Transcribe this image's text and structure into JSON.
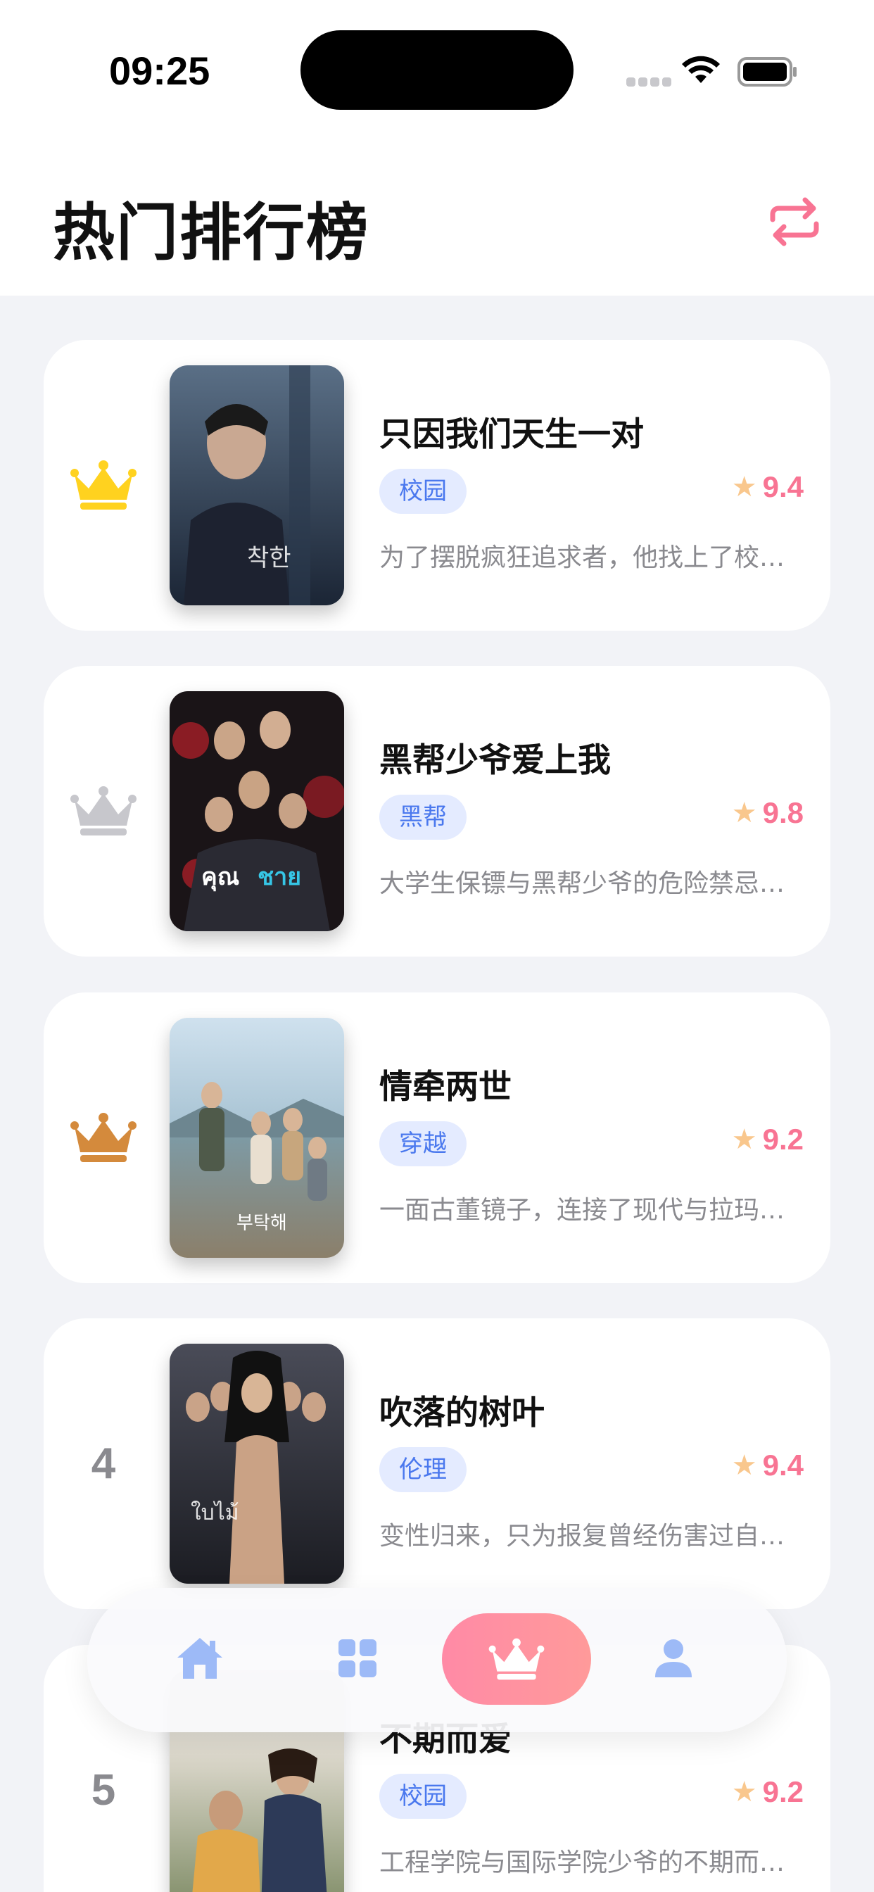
{
  "status_bar": {
    "time": "09:25"
  },
  "header": {
    "title": "热门排行榜"
  },
  "colors": {
    "accent": "#f87493",
    "tag_bg": "#e4ebff",
    "tag_text": "#4a78ee",
    "star": "#f9c78d",
    "gold": "#ffd21f",
    "silver": "#c7c7cc",
    "bronze": "#d48a3c",
    "tab_inactive": "#9dbaf7"
  },
  "rankings": [
    {
      "rank_icon": "crown-gold-icon",
      "title": "只因我们天生一对",
      "tag": "校园",
      "rating": "9.4",
      "desc": "为了摆脱疯狂追求者，他找上了校…"
    },
    {
      "rank_icon": "crown-silver-icon",
      "title": "黑帮少爷爱上我",
      "tag": "黑帮",
      "rating": "9.8",
      "desc": "大学生保镖与黑帮少爷的危险禁忌…"
    },
    {
      "rank_icon": "crown-bronze-icon",
      "title": "情牵两世",
      "tag": "穿越",
      "rating": "9.2",
      "desc": "一面古董镜子，连接了现代与拉玛…"
    },
    {
      "rank": "4",
      "title": "吹落的树叶",
      "tag": "伦理",
      "rating": "9.4",
      "desc": "变性归来，只为报复曾经伤害过自…"
    },
    {
      "rank": "5",
      "title": "不期而爱",
      "tag": "校园",
      "rating": "9.2",
      "desc": "工程学院与国际学院少爷的不期而…"
    }
  ],
  "tabbar": {
    "items": [
      {
        "icon": "home-icon",
        "active": false
      },
      {
        "icon": "grid-icon",
        "active": false
      },
      {
        "icon": "crown-icon",
        "active": true
      },
      {
        "icon": "profile-icon",
        "active": false
      }
    ]
  }
}
